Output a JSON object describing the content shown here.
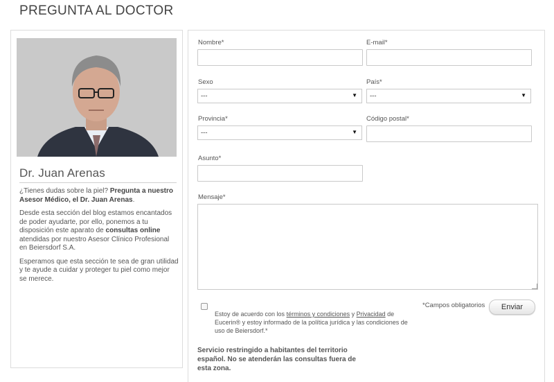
{
  "page_title": "PREGUNTA AL DOCTOR",
  "doctor": {
    "name": "Dr. Juan Arenas",
    "bio_p1_text": "¿Tienes dudas sobre la piel? ",
    "bio_p1_bold": "Pregunta a nuestro Asesor Médico, el Dr. Juan Arenas",
    "bio_p1_end": ".",
    "bio_p2_text": "Desde esta sección del blog estamos encantados de poder ayudarte, por ello, ponemos a tu disposición este aparato de ",
    "bio_p2_bold": "consultas online",
    "bio_p2_end": " atendidas por nuestro Asesor Clínico Profesional en Beiersdorf S.A.",
    "bio_p3": "Esperamos que esta sección te sea de gran utilidad y te ayude a cuidar y proteger tu piel como mejor se merece."
  },
  "form": {
    "nombre_label": "Nombre*",
    "nombre_value": "",
    "email_label": "E-mail*",
    "email_value": "",
    "sexo_label": "Sexo",
    "sexo_value": "---",
    "pais_label": "País*",
    "pais_value": "---",
    "provincia_label": "Provincia*",
    "provincia_value": "---",
    "cp_label": "Código postal*",
    "cp_value": "",
    "asunto_label": "Asunto*",
    "asunto_value": "",
    "mensaje_label": "Mensaje*",
    "mensaje_value": "",
    "terms_pre": "Estoy de acuerdo con los ",
    "terms_link1": "términos y condiciones",
    "terms_mid": " y ",
    "terms_link2": "Privacidad",
    "terms_post": " de Eucerin® y estoy informado de la política jurídica y las condiciones de uso de Beiersdorf.*",
    "terms_checked": false,
    "required_note": "*Campos obligatorios",
    "send_label": "Enviar",
    "restriction": "Servicio restringido a habitantes del territorio español. No se atenderán las consultas fuera de esta zona."
  },
  "icons": {
    "dropdown": "chevron-down-icon",
    "resize": "resize-grip-icon"
  }
}
